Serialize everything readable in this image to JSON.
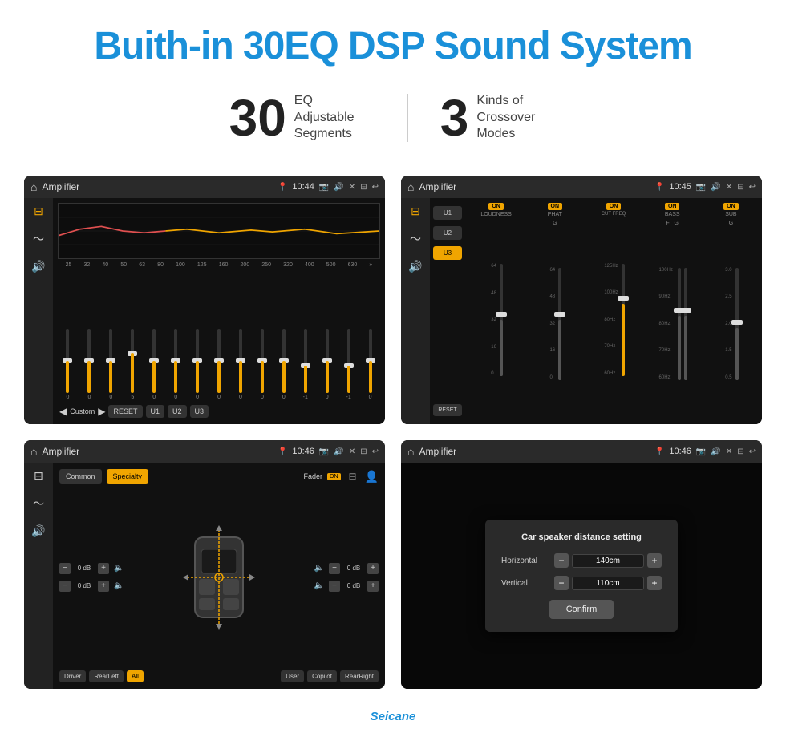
{
  "page": {
    "title": "Buith-in 30EQ DSP Sound System",
    "title_color": "#1a90d9"
  },
  "stats": [
    {
      "number": "30",
      "desc": "EQ Adjustable\nSegments"
    },
    {
      "number": "3",
      "desc": "Kinds of\nCrossover Modes"
    }
  ],
  "screens": [
    {
      "id": "screen-eq",
      "topbar": {
        "title": "Amplifier",
        "time": "10:44"
      },
      "type": "eq"
    },
    {
      "id": "screen-crossover",
      "topbar": {
        "title": "Amplifier",
        "time": "10:45"
      },
      "type": "crossover"
    },
    {
      "id": "screen-balance",
      "topbar": {
        "title": "Amplifier",
        "time": "10:46"
      },
      "type": "balance"
    },
    {
      "id": "screen-distance",
      "topbar": {
        "title": "Amplifier",
        "time": "10:46"
      },
      "type": "distance"
    }
  ],
  "eq": {
    "frequencies": [
      "25",
      "32",
      "40",
      "50",
      "63",
      "80",
      "100",
      "125",
      "160",
      "200",
      "250",
      "320",
      "400",
      "500",
      "630"
    ],
    "values": [
      "0",
      "0",
      "0",
      "5",
      "0",
      "0",
      "0",
      "0",
      "0",
      "0",
      "0",
      "-1",
      "0",
      "-1",
      "0"
    ],
    "buttons": [
      "RESET",
      "U1",
      "U2",
      "U3"
    ],
    "preset_label": "Custom"
  },
  "crossover": {
    "presets": [
      "U1",
      "U2",
      "U3"
    ],
    "active_preset": "U3",
    "channels": [
      "LOUDNESS",
      "PHAT",
      "CUT FREQ",
      "BASS",
      "SUB"
    ],
    "channel_on": [
      true,
      true,
      true,
      true,
      true
    ]
  },
  "balance": {
    "modes": [
      "Common",
      "Specialty"
    ],
    "active_mode": "Specialty",
    "fader_label": "Fader",
    "fader_on": true,
    "positions": [
      "Driver",
      "RearLeft",
      "All",
      "User",
      "Copilot",
      "RearRight"
    ],
    "active_position": "All",
    "db_values": [
      "0 dB",
      "0 dB",
      "0 dB",
      "0 dB"
    ]
  },
  "distance_dialog": {
    "title": "Car speaker distance setting",
    "horizontal_label": "Horizontal",
    "horizontal_value": "140cm",
    "vertical_label": "Vertical",
    "vertical_value": "110cm",
    "confirm_label": "Confirm"
  },
  "brand": "Seicane"
}
